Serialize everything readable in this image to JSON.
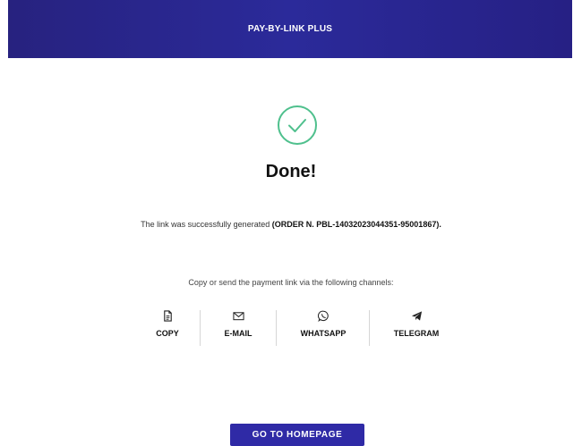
{
  "header": {
    "title": "PAY-BY-LINK PLUS"
  },
  "status": {
    "icon": "check-circle-icon",
    "title": "Done!",
    "message": "The link was successfully generated ",
    "order": "(ORDER N. PBL-14032023044351-95001867)."
  },
  "channels": {
    "caption": "Copy or send the payment link via the following channels:",
    "items": [
      {
        "label": "COPY",
        "icon": "document-icon"
      },
      {
        "label": "E-MAIL",
        "icon": "envelope-icon"
      },
      {
        "label": "WHATSAPP",
        "icon": "whatsapp-icon"
      },
      {
        "label": "TELEGRAM",
        "icon": "paper-plane-icon"
      }
    ]
  },
  "actions": {
    "home_label": "GO TO HOMEPAGE"
  },
  "colors": {
    "brand": "#2b2a9a",
    "success": "#4fc08d"
  }
}
